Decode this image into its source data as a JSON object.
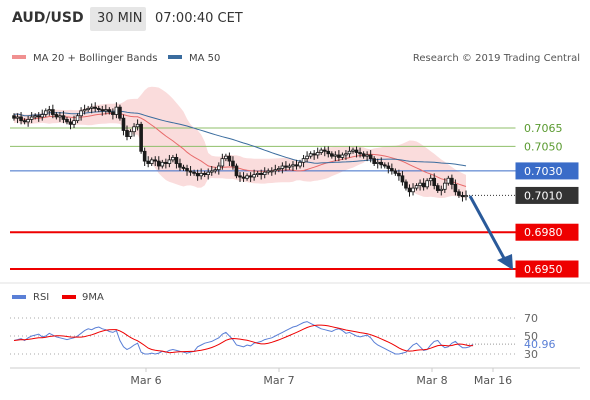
{
  "header": {
    "symbol": "AUD/USD",
    "timeframe": "30 MIN",
    "time": "07:00:40 CET"
  },
  "legend": {
    "ma20_bb": "MA 20 + Bollinger Bands",
    "ma50": "MA 50",
    "source": "Research © 2019 Trading Central",
    "rsi": "RSI",
    "ma9": "9MA"
  },
  "colors": {
    "support": "#ee0000",
    "resistance": "#8fbf6a",
    "pivot": "#3a6cc8",
    "ma20": "#e86a6a",
    "ma50": "#3a6c9e",
    "bb": "#f8d0d0",
    "rsi": "#5a7fd6",
    "up": "#1a1a1a",
    "down": "#1a1a1a",
    "forecast_arrow": "#2a5a9a"
  },
  "chart_data": {
    "type": "candlestick",
    "y_levels": [
      {
        "value": "0.7065",
        "kind": "resistance"
      },
      {
        "value": "0.7050",
        "kind": "resistance"
      },
      {
        "value": "0.7030",
        "kind": "pivot"
      },
      {
        "value": "0.7010",
        "kind": "last-price"
      },
      {
        "value": "0.6980",
        "kind": "support"
      },
      {
        "value": "0.6950",
        "kind": "support"
      }
    ],
    "x_labels": [
      "Mar 6",
      "Mar 7",
      "Mar 8",
      "Mar 16"
    ],
    "close": [
      0.7073,
      0.7074,
      0.7071,
      0.707,
      0.7072,
      0.7074,
      0.7075,
      0.7074,
      0.7076,
      0.7079,
      0.708,
      0.7076,
      0.7074,
      0.7075,
      0.7072,
      0.707,
      0.7068,
      0.7071,
      0.7075,
      0.7079,
      0.708,
      0.7081,
      0.7082,
      0.7081,
      0.708,
      0.7079,
      0.708,
      0.7078,
      0.7076,
      0.7082,
      0.7073,
      0.7063,
      0.7058,
      0.7062,
      0.7066,
      0.7068,
      0.7046,
      0.7038,
      0.7036,
      0.7039,
      0.7038,
      0.7034,
      0.7037,
      0.7036,
      0.7039,
      0.7041,
      0.7036,
      0.7033,
      0.7032,
      0.703,
      0.7029,
      0.7028,
      0.7026,
      0.7028,
      0.7027,
      0.7029,
      0.703,
      0.7031,
      0.7034,
      0.704,
      0.7042,
      0.7038,
      0.7034,
      0.7026,
      0.7025,
      0.7024,
      0.7026,
      0.7025,
      0.7027,
      0.7028,
      0.7027,
      0.7029,
      0.703,
      0.703,
      0.7031,
      0.7032,
      0.7034,
      0.7033,
      0.7034,
      0.7035,
      0.7034,
      0.7037,
      0.704,
      0.7042,
      0.7044,
      0.7043,
      0.7045,
      0.7047,
      0.7046,
      0.7044,
      0.7042,
      0.7043,
      0.7041,
      0.7043,
      0.7044,
      0.7046,
      0.7047,
      0.7045,
      0.7044,
      0.7042,
      0.7043,
      0.704,
      0.7036,
      0.7037,
      0.7035,
      0.7034,
      0.7032,
      0.703,
      0.7028,
      0.7026,
      0.7021,
      0.7016,
      0.7013,
      0.7016,
      0.7018,
      0.702,
      0.7017,
      0.7022,
      0.7024,
      0.7018,
      0.7014,
      0.7015,
      0.702,
      0.7024,
      0.7019,
      0.7013,
      0.701,
      0.7009,
      0.701
    ],
    "bollinger": {
      "ma20_color": "#e86a6a",
      "band_fill": "#f8d0d0"
    },
    "ma50": "trend line",
    "forecast": "arrow pointing down from last price toward 0.6950",
    "rsi": {
      "levels": [
        "70",
        "50",
        "30"
      ],
      "current": "40.96",
      "values": [
        45,
        46,
        47,
        45,
        48,
        50,
        51,
        52,
        49,
        50,
        53,
        51,
        49,
        48,
        47,
        46,
        47,
        48,
        50,
        53,
        56,
        58,
        57,
        59,
        60,
        58,
        57,
        55,
        54,
        56,
        45,
        38,
        35,
        37,
        40,
        42,
        32,
        30,
        30,
        31,
        30,
        31,
        33,
        32,
        34,
        35,
        34,
        33,
        32,
        31,
        32,
        33,
        38,
        40,
        42,
        43,
        44,
        46,
        48,
        52,
        54,
        50,
        46,
        40,
        39,
        38,
        40,
        39,
        42,
        43,
        44,
        46,
        47,
        48,
        50,
        52,
        54,
        56,
        58,
        60,
        61,
        63,
        65,
        66,
        64,
        62,
        60,
        58,
        57,
        56,
        55,
        57,
        58,
        56,
        53,
        54,
        52,
        50,
        49,
        50,
        51,
        48,
        43,
        40,
        38,
        36,
        34,
        32,
        30,
        30,
        31,
        32,
        36,
        40,
        42,
        38,
        34,
        35,
        40,
        44,
        45,
        40,
        37,
        38,
        42,
        44,
        40,
        37,
        37,
        38,
        41
      ]
    }
  }
}
